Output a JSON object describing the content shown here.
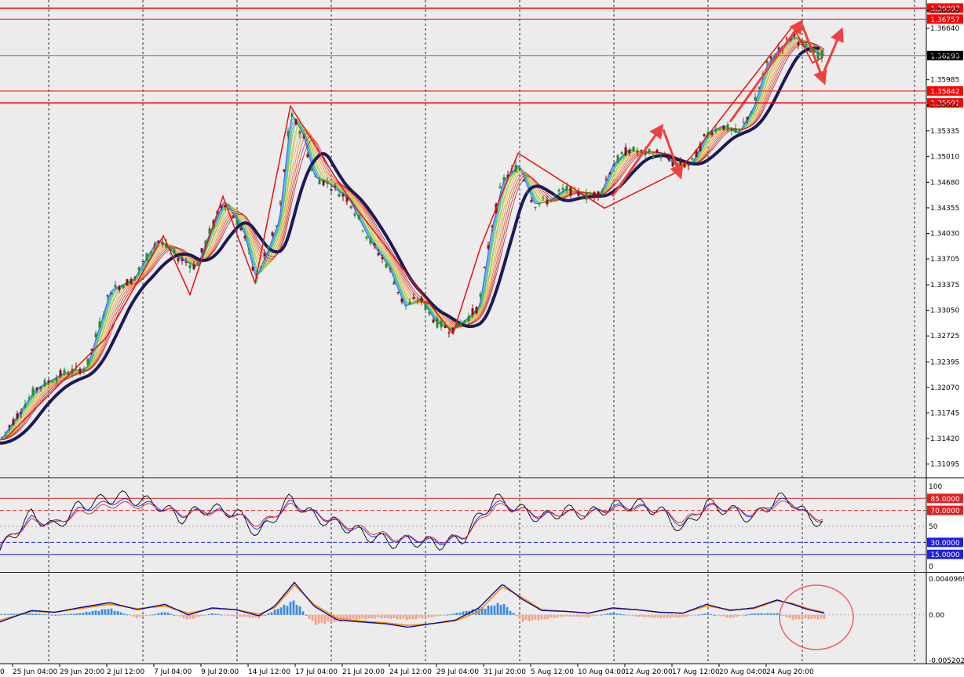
{
  "colors": {
    "background": "#ececec",
    "bull": "#2a8a2a",
    "bear": "#8a1010",
    "level_line": "#ff0000",
    "current_line": "#3060d0",
    "ma_thick": "#1a1a5a",
    "zigzag": "#e81010",
    "arrow": "#f04040",
    "macd_pos": "#3b8de0",
    "macd_neg": "#f4a080",
    "macd_line": "#0a0a9a",
    "signal_line": "#ff8c00",
    "stoch_main": "#000000",
    "stoch_blue": "#2020e0",
    "stoch_red": "#e02020"
  },
  "chart_data": [
    {
      "panel": "price",
      "type": "candlestick",
      "ylim": [
        1.3093,
        1.37
      ],
      "y_ticks": [
        "1.36865",
        "1.36640",
        "1.36315",
        "1.35985",
        "1.35660",
        "1.35335",
        "1.35010",
        "1.34680",
        "1.34355",
        "1.34030",
        "1.33705",
        "1.33375",
        "1.33050",
        "1.32725",
        "1.32395",
        "1.32070",
        "1.31745",
        "1.31420",
        "1.31095"
      ],
      "x_ticks": [
        "25 Jun 04:00",
        "29 Jun 20:00",
        "2 Jul 12:00",
        "7 Jul 04:00",
        "9 Jul 20:00",
        "14 Jul 12:00",
        "17 Jul 04:00",
        "21 Jul 20:00",
        "24 Jul 12:00",
        "29 Jul 04:00",
        "31 Jul 20:00",
        "5 Aug 12:00",
        "10 Aug 04:00",
        "12 Aug 20:00",
        "17 Aug 12:00",
        "20 Aug 04:00",
        "24 Aug 20:00"
      ],
      "levels": [
        {
          "label": "1.36897",
          "value": 1.36897
        },
        {
          "label": "1.36757",
          "value": 1.36757
        },
        {
          "label": "1.35842",
          "value": 1.35842
        },
        {
          "label": "1.35691",
          "value": 1.35691
        }
      ],
      "current_price": {
        "label": "1.36293",
        "value": 1.36293
      },
      "path_points": [
        [
          0,
          1.314
        ],
        [
          45,
          1.3205
        ],
        [
          80,
          1.3225
        ],
        [
          110,
          1.3232
        ],
        [
          140,
          1.333
        ],
        [
          170,
          1.3345
        ],
        [
          200,
          1.3395
        ],
        [
          230,
          1.337
        ],
        [
          250,
          1.336
        ],
        [
          265,
          1.34
        ],
        [
          285,
          1.3445
        ],
        [
          310,
          1.3405
        ],
        [
          325,
          1.3345
        ],
        [
          340,
          1.338
        ],
        [
          355,
          1.342
        ],
        [
          370,
          1.3555
        ],
        [
          385,
          1.353
        ],
        [
          400,
          1.3475
        ],
        [
          420,
          1.3465
        ],
        [
          445,
          1.3445
        ],
        [
          470,
          1.3395
        ],
        [
          495,
          1.336
        ],
        [
          515,
          1.331
        ],
        [
          535,
          1.332
        ],
        [
          555,
          1.329
        ],
        [
          575,
          1.328
        ],
        [
          595,
          1.3295
        ],
        [
          610,
          1.331
        ],
        [
          625,
          1.3405
        ],
        [
          640,
          1.347
        ],
        [
          660,
          1.349
        ],
        [
          680,
          1.344
        ],
        [
          700,
          1.3445
        ],
        [
          720,
          1.346
        ],
        [
          745,
          1.345
        ],
        [
          765,
          1.3455
        ],
        [
          780,
          1.349
        ],
        [
          800,
          1.351
        ],
        [
          820,
          1.3505
        ],
        [
          840,
          1.3505
        ],
        [
          860,
          1.349
        ],
        [
          880,
          1.349
        ],
        [
          900,
          1.353
        ],
        [
          920,
          1.354
        ],
        [
          940,
          1.353
        ],
        [
          960,
          1.3565
        ],
        [
          975,
          1.3615
        ],
        [
          990,
          1.3635
        ],
        [
          1010,
          1.3655
        ],
        [
          1025,
          1.364
        ],
        [
          1040,
          1.3632
        ],
        [
          1050,
          1.3629
        ]
      ],
      "zigzag": [
        [
          5,
          1.314
        ],
        [
          135,
          1.327
        ],
        [
          208,
          1.34
        ],
        [
          242,
          1.3325
        ],
        [
          284,
          1.345
        ],
        [
          325,
          1.334
        ],
        [
          370,
          1.3565
        ],
        [
          430,
          1.347
        ],
        [
          450,
          1.344
        ],
        [
          577,
          1.3275
        ],
        [
          612,
          1.3385
        ],
        [
          660,
          1.3505
        ],
        [
          770,
          1.3435
        ],
        [
          860,
          1.348
        ],
        [
          880,
          1.35
        ],
        [
          1010,
          1.3667
        ],
        [
          1035,
          1.362
        ],
        [
          1048,
          1.3627
        ]
      ],
      "arrows": [
        [
          [
            780,
            1.345
          ],
          [
            840,
            1.3535
          ]
        ],
        [
          [
            845,
            1.3535
          ],
          [
            865,
            1.348
          ]
        ],
        [
          [
            930,
            1.3545
          ],
          [
            1018,
            1.3668
          ]
        ],
        [
          [
            1022,
            1.3668
          ],
          [
            1048,
            1.36
          ]
        ],
        [
          [
            1050,
            1.361
          ],
          [
            1070,
            1.3657
          ]
        ]
      ]
    },
    {
      "panel": "stochastic",
      "type": "line",
      "ylim": [
        0,
        100
      ],
      "y_ticks": [
        "100",
        "50",
        "0"
      ],
      "levels": [
        {
          "label": "85.0000",
          "value": 85
        },
        {
          "label": "70.0000",
          "value": 70
        },
        {
          "label": "30.0000",
          "value": 30
        },
        {
          "label": "15.0000",
          "value": 15
        }
      ],
      "x": [
        0,
        40,
        70,
        100,
        150,
        200,
        230,
        260,
        300,
        330,
        370,
        400,
        440,
        470,
        500,
        530,
        560,
        590,
        610,
        630,
        660,
        690,
        720,
        750,
        780,
        810,
        840,
        870,
        900,
        930,
        960,
        990,
        1010,
        1030,
        1050
      ],
      "series": [
        {
          "values": [
            20,
            65,
            48,
            75,
            88,
            78,
            60,
            72,
            68,
            40,
            85,
            62,
            50,
            38,
            30,
            32,
            28,
            35,
            62,
            85,
            72,
            60,
            70,
            65,
            75,
            78,
            70,
            45,
            78,
            70,
            60,
            85,
            82,
            60,
            55
          ]
        },
        {
          "values": [
            25,
            60,
            52,
            70,
            82,
            76,
            64,
            70,
            66,
            48,
            80,
            66,
            50,
            42,
            34,
            34,
            30,
            36,
            58,
            80,
            72,
            62,
            68,
            66,
            74,
            75,
            70,
            52,
            76,
            72,
            64,
            82,
            80,
            62,
            58
          ]
        },
        {
          "values": [
            28,
            56,
            54,
            66,
            78,
            74,
            66,
            68,
            65,
            52,
            76,
            67,
            52,
            45,
            36,
            35,
            32,
            37,
            55,
            76,
            72,
            64,
            67,
            66,
            72,
            73,
            70,
            56,
            74,
            72,
            66,
            78,
            78,
            64,
            60
          ]
        }
      ]
    },
    {
      "panel": "macd",
      "type": "bar",
      "ylim": [
        -0.005202,
        0.004096
      ],
      "y_ticks": [
        "0.0040969",
        "0.00",
        "-0.005202"
      ],
      "x": [
        0,
        40,
        70,
        100,
        140,
        175,
        210,
        240,
        270,
        300,
        330,
        350,
        375,
        400,
        430,
        460,
        490,
        520,
        550,
        580,
        610,
        640,
        665,
        690,
        720,
        750,
        780,
        810,
        840,
        870,
        900,
        930,
        960,
        990,
        1010,
        1030,
        1050
      ],
      "series": [
        {
          "values": [
            -0.0008,
            0.0005,
            0.0003,
            0.0008,
            0.0014,
            0.0006,
            0.0012,
            0.0,
            0.0008,
            0.0006,
            -0.0001,
            0.001,
            0.0037,
            0.001,
            -0.0006,
            -0.0008,
            -0.001,
            -0.0014,
            -0.001,
            -0.0006,
            0.0008,
            0.0035,
            0.0018,
            0.0005,
            0.0004,
            0.0002,
            0.0008,
            0.0006,
            0.0003,
            0.0002,
            0.0012,
            0.0005,
            0.0008,
            0.0017,
            0.0012,
            0.0006,
            0.0002
          ]
        },
        {
          "values": [
            -0.0006,
            0.0004,
            0.0003,
            0.0007,
            0.0012,
            0.0007,
            0.001,
            0.0002,
            0.0007,
            0.0006,
            0.0001,
            0.0008,
            0.0034,
            0.0012,
            -0.0004,
            -0.0007,
            -0.0009,
            -0.0012,
            -0.001,
            -0.0007,
            0.0004,
            0.0032,
            0.002,
            0.0006,
            0.0004,
            0.0002,
            0.0007,
            0.0006,
            0.0003,
            0.0002,
            0.001,
            0.0006,
            0.0007,
            0.0016,
            0.0013,
            0.0007,
            0.0003
          ]
        },
        {
          "values": [
            0.0001,
            0.0002,
            0.0,
            0.0002,
            0.0008,
            -0.0004,
            0.0004,
            -0.0006,
            0.0002,
            -0.0002,
            -0.0004,
            0.0006,
            0.0018,
            -0.0012,
            -0.0008,
            -0.0005,
            -0.0004,
            -0.0006,
            -0.0003,
            0.0002,
            0.0008,
            0.0015,
            -0.0008,
            -0.0006,
            -0.0002,
            -0.0003,
            0.0003,
            -0.0002,
            -0.0004,
            -0.0003,
            0.0002,
            -0.0004,
            0.0002,
            0.0002,
            -0.0006,
            -0.0005,
            -0.0005
          ]
        }
      ]
    }
  ]
}
